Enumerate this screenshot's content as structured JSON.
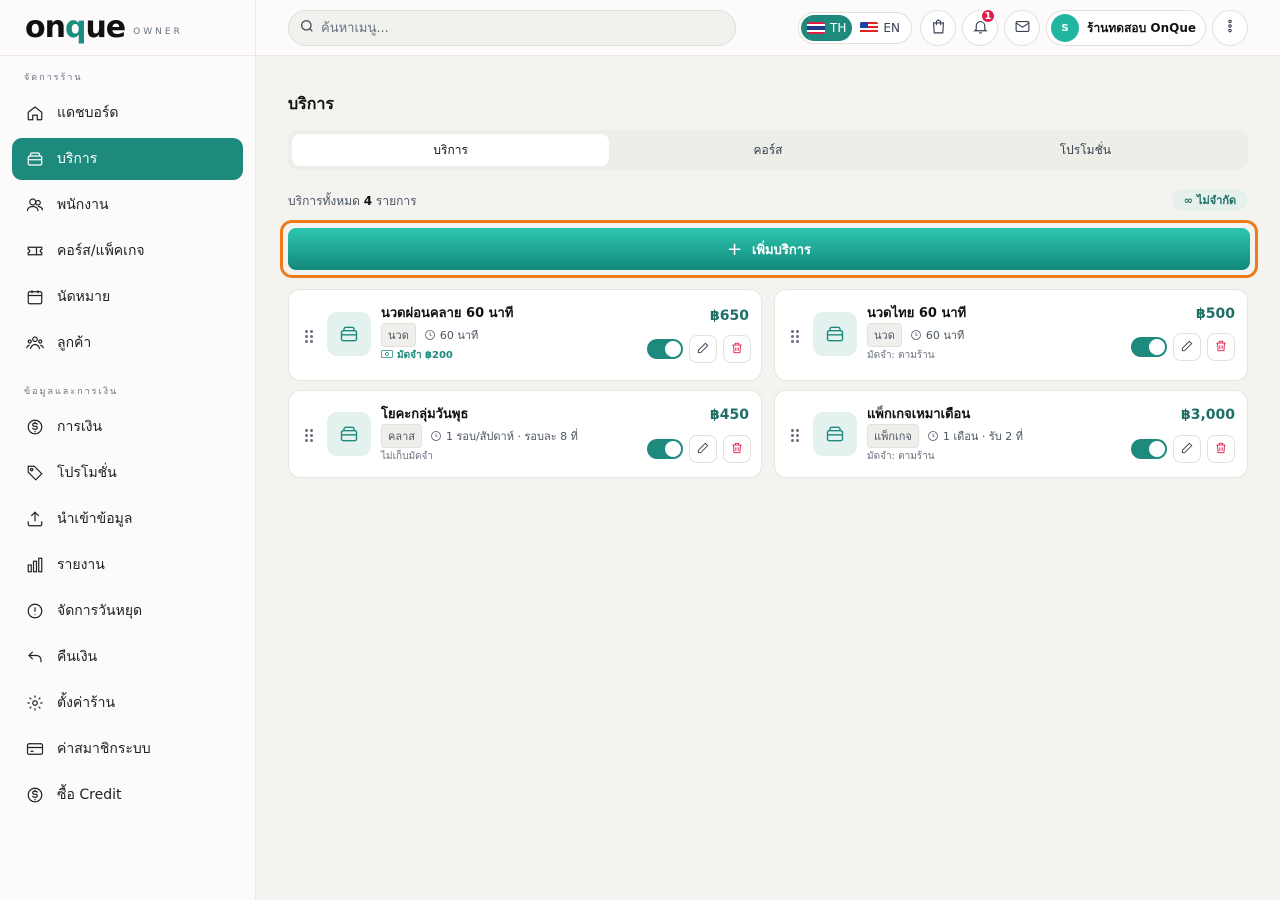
{
  "brand": {
    "logo_a": "on",
    "logo_q": "q",
    "logo_b": "ue",
    "sub": "OWNER"
  },
  "sidebar": {
    "section1": "จัดการร้าน",
    "section2": "ข้อมูลและการเงิน",
    "items": [
      {
        "label": "แดชบอร์ด",
        "icon": "home-icon"
      },
      {
        "label": "บริการ",
        "icon": "box-icon"
      },
      {
        "label": "พนักงาน",
        "icon": "users-icon"
      },
      {
        "label": "คอร์ส/แพ็คเกจ",
        "icon": "ticket-icon"
      },
      {
        "label": "นัดหมาย",
        "icon": "calendar-icon"
      },
      {
        "label": "ลูกค้า",
        "icon": "customers-icon"
      },
      {
        "label": "การเงิน",
        "icon": "dollar-icon"
      },
      {
        "label": "โปรโมชั่น",
        "icon": "tag-icon"
      },
      {
        "label": "นำเข้าข้อมูล",
        "icon": "upload-icon"
      },
      {
        "label": "รายงาน",
        "icon": "bar-chart-icon"
      },
      {
        "label": "จัดการวันหยุด",
        "icon": "alert-icon"
      },
      {
        "label": "คืนเงิน",
        "icon": "undo-icon"
      },
      {
        "label": "ตั้งค่าร้าน",
        "icon": "gear-icon"
      },
      {
        "label": "ค่าสมาชิกระบบ",
        "icon": "credit-card-icon"
      },
      {
        "label": "ซื้อ Credit",
        "icon": "dollar-icon"
      }
    ]
  },
  "topbar": {
    "search_placeholder": "ค้นหาเมนู...",
    "lang_th": "TH",
    "lang_en": "EN",
    "notification_count": "1",
    "avatar_initial": "S",
    "shop_name": "ร้านทดสอบ OnQue"
  },
  "main": {
    "title": "บริการ",
    "tabs": [
      "บริการ",
      "คอร์ส",
      "โปรโมชั่น"
    ],
    "summary_prefix": "บริการทั้งหมด",
    "summary_count": "4",
    "summary_suffix": "รายการ",
    "unlimited_label": "ไม่จำกัด",
    "add_label": "เพิ่มบริการ",
    "services": [
      {
        "name": "นวดผ่อนคลาย 60 นาที",
        "category": "นวด",
        "duration": "60 นาที",
        "deposit": "มัดจำ ฿200",
        "price": "฿650",
        "enabled": true
      },
      {
        "name": "นวดไทย 60 นาที",
        "category": "นวด",
        "duration": "60 นาที",
        "deposit": "มัดจำ: ตามร้าน",
        "price": "฿500",
        "enabled": true
      },
      {
        "name": "โยคะกลุ่มวันพุธ",
        "category": "คลาส",
        "duration": "1 รอบ/สัปดาห์ · รอบละ 8 ที่",
        "deposit": "ไม่เก็บมัดจำ",
        "price": "฿450",
        "enabled": true
      },
      {
        "name": "แพ็กเกจเหมาเดือน",
        "category": "แพ็กเกจ",
        "duration": "1 เดือน · รับ 2 ที่",
        "deposit": "มัดจำ: ตามร้าน",
        "price": "฿3,000",
        "enabled": true
      }
    ]
  },
  "colors": {
    "accent": "#1d8a7d",
    "highlight": "#ef7a1a",
    "danger": "#e11d48"
  }
}
